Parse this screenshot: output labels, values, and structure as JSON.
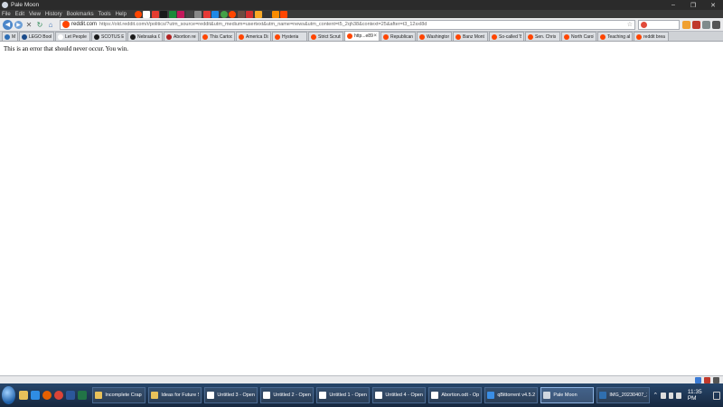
{
  "window": {
    "title": "Pale Moon"
  },
  "menu": {
    "items": [
      "File",
      "Edit",
      "View",
      "History",
      "Bookmarks",
      "Tools",
      "Help"
    ]
  },
  "nav": {
    "site_domain": "reddit.com",
    "url": "https://old.reddit.com/r/politics/?utm_source=reddit&utm_medium=usertext&utm_name=news&utm_content=t5_2qh38&context=25&after=t3_12sxl8d"
  },
  "tabs": [
    {
      "label": "Ma",
      "fav": "#2c6db5"
    },
    {
      "label": "LEGO Books",
      "fav": "#1b4b8a"
    },
    {
      "label": "Let People",
      "fav": "#ffffff"
    },
    {
      "label": "SCOTUS Ext",
      "fav": "#1a1a1a"
    },
    {
      "label": "Nebraska G",
      "fav": "#1a1a1a"
    },
    {
      "label": "Abortion rei",
      "fav": "#b22222"
    },
    {
      "label": "This Cartoo",
      "fav": "#ff4500"
    },
    {
      "label": "America Dis",
      "fav": "#ff4500"
    },
    {
      "label": "Hysteria",
      "fav": "#ff4500"
    },
    {
      "label": "Strict Scrutiny",
      "fav": "#ff4500"
    },
    {
      "label": "http...e89d",
      "fav": "#ff4500",
      "active": true
    },
    {
      "label": "Republican",
      "fav": "#ff4500"
    },
    {
      "label": "Washington",
      "fav": "#ff4500"
    },
    {
      "label": "Banz Mont",
      "fav": "#ff4500"
    },
    {
      "label": "So-called 'B",
      "fav": "#ff4500"
    },
    {
      "label": "Sen. Chris",
      "fav": "#ff4500"
    },
    {
      "label": "North Carol",
      "fav": "#ff4500"
    },
    {
      "label": "Teaching ab",
      "fav": "#ff4500"
    },
    {
      "label": "reddit brea",
      "fav": "#ff4500"
    }
  ],
  "content": {
    "message": "This is an error that should never occur. You win."
  },
  "taskbar": {
    "items": [
      {
        "label": "Incomplete Crap",
        "icon": "#e8c15a"
      },
      {
        "label": "Ideas for Future St...",
        "icon": "#e8c15a"
      },
      {
        "label": "Untitled 3 - OpenO...",
        "icon": "#ffffff"
      },
      {
        "label": "Untitled 2 - OpenO...",
        "icon": "#ffffff"
      },
      {
        "label": "Untitled 1 - OpenO...",
        "icon": "#ffffff"
      },
      {
        "label": "Untitled 4 - OpenO...",
        "icon": "#ffffff"
      },
      {
        "label": "Abortion.odt - Ope...",
        "icon": "#ffffff"
      },
      {
        "label": "qBittorrent v4.5.2",
        "icon": "#3a8ee6"
      },
      {
        "label": "Pale Moon",
        "icon": "#cfd6e0",
        "active": true
      },
      {
        "label": "IMG_20230407_204...",
        "icon": "#2f6fb0"
      }
    ],
    "time": "11:35 PM"
  }
}
